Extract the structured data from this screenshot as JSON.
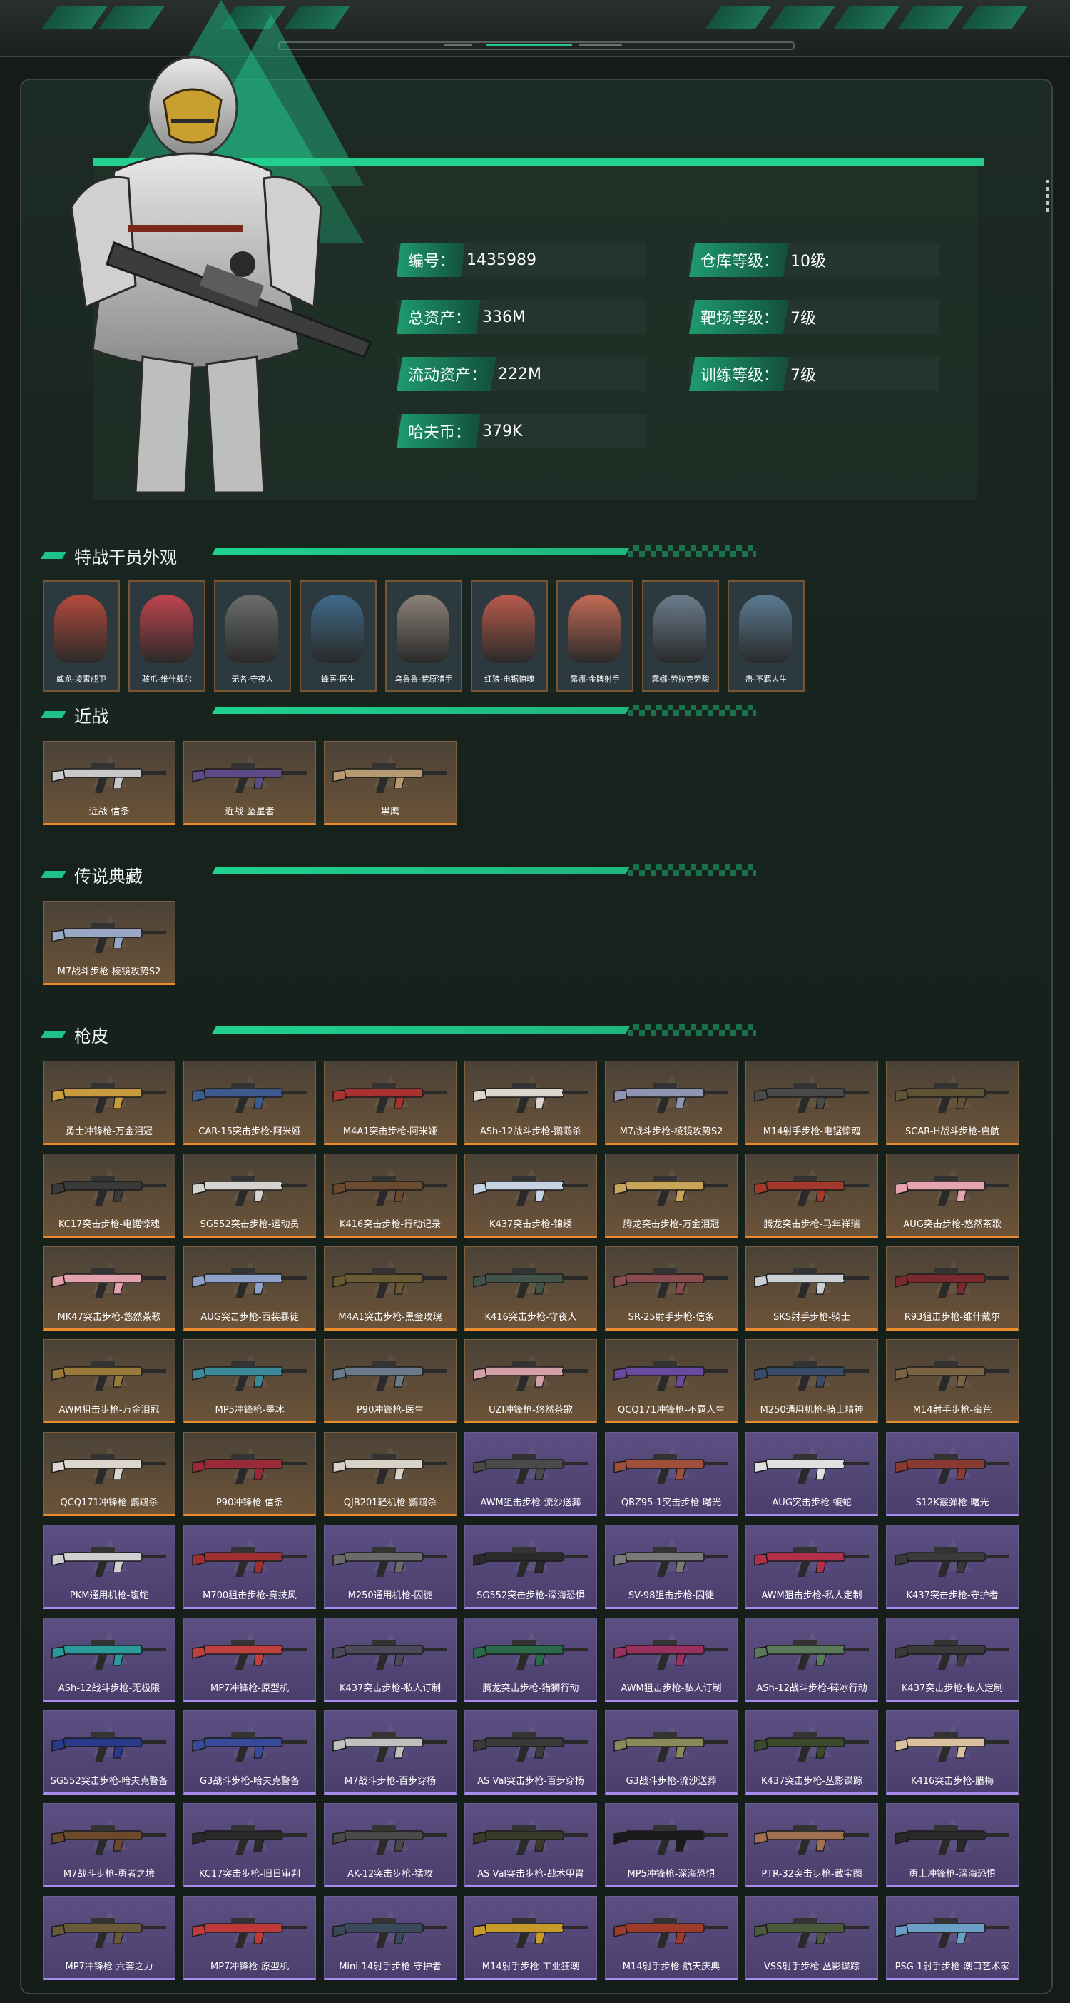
{
  "profile": {
    "stats": [
      {
        "label": "编号：",
        "value": "1435989"
      },
      {
        "label": "仓库等级：",
        "value": "10级"
      },
      {
        "label": "总资产：",
        "value": "336M"
      },
      {
        "label": "靶场等级：",
        "value": "7级"
      },
      {
        "label": "流动资产：",
        "value": "222M"
      },
      {
        "label": "训练等级：",
        "value": "7级"
      },
      {
        "label": "哈夫币：",
        "value": "379K"
      }
    ]
  },
  "sections": {
    "operators_title": "特战干员外观",
    "melee_title": "近战",
    "legendary_title": "传说典藏",
    "skins_title": "枪皮"
  },
  "operators": [
    {
      "name": "威龙-凌霄戍卫",
      "color": "#b64a3c"
    },
    {
      "name": "骇爪-维什戴尔",
      "color": "#c0444e"
    },
    {
      "name": "无名-守夜人",
      "color": "#6b6e6d"
    },
    {
      "name": "蜂医-医生",
      "color": "#3f6a8a"
    },
    {
      "name": "乌鲁鲁-荒原猎手",
      "color": "#8c8278"
    },
    {
      "name": "红狼-电锯惊魂",
      "color": "#b95b4c"
    },
    {
      "name": "露娜-金牌射手",
      "color": "#c56a55"
    },
    {
      "name": "露娜-劳拉克劳馥",
      "color": "#6a7d8e"
    },
    {
      "name": "蛊-不羁人生",
      "color": "#5a7b93"
    }
  ],
  "melee": [
    {
      "name": "近战-信条",
      "color": "#c9c9cc"
    },
    {
      "name": "近战-坠星者",
      "color": "#5d4a86"
    },
    {
      "name": "黑鹰",
      "color": "#b89a72"
    }
  ],
  "legendary": [
    {
      "name": "M7战斗步枪-棱镜攻势S2",
      "color": "#9aa7c4"
    }
  ],
  "skins": [
    {
      "name": "勇士冲锋枪-万金泪冠",
      "rarity": "orange",
      "color": "#c89b3c"
    },
    {
      "name": "CAR-15突击步枪-阿米娅",
      "rarity": "orange",
      "color": "#3d5b8f"
    },
    {
      "name": "M4A1突击步枪-阿米娅",
      "rarity": "orange",
      "color": "#a8322f"
    },
    {
      "name": "ASh-12战斗步枪-鹦鹉杀",
      "rarity": "orange",
      "color": "#dcd6cf"
    },
    {
      "name": "M7战斗步枪-棱镜攻势S2",
      "rarity": "orange",
      "color": "#8e94b2"
    },
    {
      "name": "M14射手步枪-电锯惊魂",
      "rarity": "orange",
      "color": "#4a4a4a"
    },
    {
      "name": "SCAR-H战斗步枪-启航",
      "rarity": "orange",
      "color": "#5e5335"
    },
    {
      "name": "KC17突击步枪-电锯惊魂",
      "rarity": "orange",
      "color": "#3a3a3a"
    },
    {
      "name": "SG552突击步枪-运动员",
      "rarity": "orange",
      "color": "#d5d3cf"
    },
    {
      "name": "K416突击步枪-行动记录",
      "rarity": "orange",
      "color": "#6b4a30"
    },
    {
      "name": "K437突击步枪-锦绣",
      "rarity": "orange",
      "color": "#c7d3e3"
    },
    {
      "name": "腾龙突击步枪-万金泪冠",
      "rarity": "orange",
      "color": "#c9a55a"
    },
    {
      "name": "腾龙突击步枪-马年祥瑞",
      "rarity": "orange",
      "color": "#a2392c"
    },
    {
      "name": "AUG突击步枪-悠然茶歌",
      "rarity": "orange",
      "color": "#e6a3b0"
    },
    {
      "name": "MK47突击步枪-悠然茶歌",
      "rarity": "orange",
      "color": "#e3a0ad"
    },
    {
      "name": "AUG突击步枪-西装暴徒",
      "rarity": "orange",
      "color": "#8da0c8"
    },
    {
      "name": "M4A1突击步枪-黑金玫瑰",
      "rarity": "orange",
      "color": "#6a5a34"
    },
    {
      "name": "K416突击步枪-守夜人",
      "rarity": "orange",
      "color": "#44534a"
    },
    {
      "name": "SR-25射手步枪-信条",
      "rarity": "orange",
      "color": "#8a4b4f"
    },
    {
      "name": "SKS射手步枪-骑士",
      "rarity": "orange",
      "color": "#c9cfd3"
    },
    {
      "name": "R93狙击步枪-维什戴尔",
      "rarity": "orange",
      "color": "#7a2a2e"
    },
    {
      "name": "AWM狙击步枪-万金泪冠",
      "rarity": "orange",
      "color": "#9a7a3a"
    },
    {
      "name": "MP5冲锋枪-墨冰",
      "rarity": "orange",
      "color": "#3a8a9a"
    },
    {
      "name": "P90冲锋枪-医生",
      "rarity": "orange",
      "color": "#6a7a8a"
    },
    {
      "name": "UZI冲锋枪-悠然茶歌",
      "rarity": "orange",
      "color": "#d4a0a8"
    },
    {
      "name": "QCQ171冲锋枪-不羁人生",
      "rarity": "orange",
      "color": "#6a4aa0"
    },
    {
      "name": "M250通用机枪-骑士精神",
      "rarity": "orange",
      "color": "#3a4c6a"
    },
    {
      "name": "M14射手步枪-蛮荒",
      "rarity": "orange",
      "color": "#7a6444"
    },
    {
      "name": "QCQ171冲锋枪-鹦鹉杀",
      "rarity": "orange",
      "color": "#dcd6cf"
    },
    {
      "name": "P90冲锋枪-信条",
      "rarity": "orange",
      "color": "#9a2a36"
    },
    {
      "name": "QJB201轻机枪-鹦鹉杀",
      "rarity": "orange",
      "color": "#d8d2c8"
    },
    {
      "name": "AWM狙击步枪-流沙送葬",
      "rarity": "purple",
      "color": "#4a4a4a"
    },
    {
      "name": "QBZ95-1突击步枪-曙光",
      "rarity": "purple",
      "color": "#a0503a"
    },
    {
      "name": "AUG突击步枪-蝮蛇",
      "rarity": "purple",
      "color": "#e0e0e0"
    },
    {
      "name": "S12K霰弹枪-曙光",
      "rarity": "purple",
      "color": "#8a3a30"
    },
    {
      "name": "PKM通用机枪-蝮蛇",
      "rarity": "purple",
      "color": "#d0d0d0"
    },
    {
      "name": "M700狙击步枪-竞技风",
      "rarity": "purple",
      "color": "#a03030"
    },
    {
      "name": "M250通用机枪-囚徒",
      "rarity": "purple",
      "color": "#6a6a6a"
    },
    {
      "name": "SG552突击步枪-深海恐惧",
      "rarity": "purple",
      "color": "#2a2a2a"
    },
    {
      "name": "SV-98狙击步枪-囚徒",
      "rarity": "purple",
      "color": "#7a7a7a"
    },
    {
      "name": "AWM狙击步枪-私人定制",
      "rarity": "purple",
      "color": "#b0304a"
    },
    {
      "name": "K437突击步枪-守护者",
      "rarity": "purple",
      "color": "#3a3a3a"
    },
    {
      "name": "ASh-12战斗步枪-无极限",
      "rarity": "purple",
      "color": "#2a9a9a"
    },
    {
      "name": "MP7冲锋枪-原型机",
      "rarity": "purple",
      "color": "#c04040"
    },
    {
      "name": "K437突击步枪-私人订制",
      "rarity": "purple",
      "color": "#4a4a5a"
    },
    {
      "name": "腾龙突击步枪-猎狮行动",
      "rarity": "purple",
      "color": "#2a6a4a"
    },
    {
      "name": "AWM狙击步枪-私人订制",
      "rarity": "purple",
      "color": "#9a3060"
    },
    {
      "name": "ASh-12战斗步枪-碎冰行动",
      "rarity": "purple",
      "color": "#5a7a5a"
    },
    {
      "name": "K437突击步枪-私人定制",
      "rarity": "purple",
      "color": "#3a3a3a"
    },
    {
      "name": "SG552突击步枪-哈夫克警备",
      "rarity": "purple",
      "color": "#2a3a8a"
    },
    {
      "name": "G3战斗步枪-哈夫克警备",
      "rarity": "purple",
      "color": "#3a4a9a"
    },
    {
      "name": "M7战斗步枪-百步穿杨",
      "rarity": "purple",
      "color": "#c0c0c0"
    },
    {
      "name": "AS Val突击步枪-百步穿杨",
      "rarity": "purple",
      "color": "#3a3a3a"
    },
    {
      "name": "G3战斗步枪-流沙送葬",
      "rarity": "purple",
      "color": "#8a8a5a"
    },
    {
      "name": "K437突击步枪-丛影谍踪",
      "rarity": "purple",
      "color": "#3a4a2a"
    },
    {
      "name": "K416突击步枪-腊梅",
      "rarity": "purple",
      "color": "#d8c0a0"
    },
    {
      "name": "M7战斗步枪-勇者之境",
      "rarity": "purple",
      "color": "#6a4a2a"
    },
    {
      "name": "KC17突击步枪-旧日审判",
      "rarity": "purple",
      "color": "#2a2a2a"
    },
    {
      "name": "AK-12突击步枪-猛攻",
      "rarity": "purple",
      "color": "#4a4a4a"
    },
    {
      "name": "AS Val突击步枪-战术甲胄",
      "rarity": "purple",
      "color": "#3a3a2a"
    },
    {
      "name": "MP5冲锋枪-深海恐惧",
      "rarity": "purple",
      "color": "#1a1a1a"
    },
    {
      "name": "PTR-32突击步枪-藏宝图",
      "rarity": "purple",
      "color": "#a07050"
    },
    {
      "name": "勇士冲锋枪-深海恐惧",
      "rarity": "purple",
      "color": "#2a2a2a"
    },
    {
      "name": "MP7冲锋枪-六套之力",
      "rarity": "purple",
      "color": "#6a5a3a"
    },
    {
      "name": "MP7冲锋枪-原型机",
      "rarity": "purple",
      "color": "#c03a3a"
    },
    {
      "name": "Mini-14射手步枪-守护者",
      "rarity": "purple",
      "color": "#3a4a5a"
    },
    {
      "name": "M14射手步枪-工业狂潮",
      "rarity": "purple",
      "color": "#c89a2a"
    },
    {
      "name": "M14射手步枪-航天庆典",
      "rarity": "purple",
      "color": "#a03a2a"
    },
    {
      "name": "VSS射手步枪-丛影谍踪",
      "rarity": "purple",
      "color": "#4a5a3a"
    },
    {
      "name": "PSG-1射手步枪-潮口艺术家",
      "rarity": "purple",
      "color": "#6aa0c8"
    }
  ]
}
